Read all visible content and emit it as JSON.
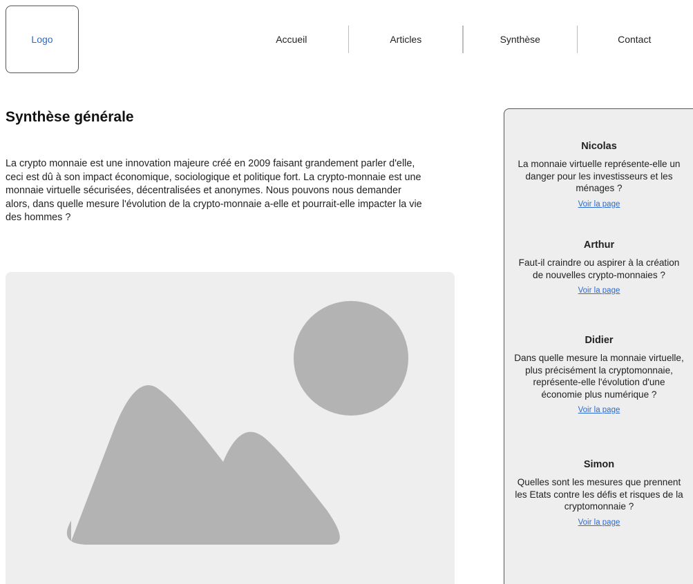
{
  "header": {
    "logo_label": "Logo",
    "nav": [
      {
        "label": "Accueil"
      },
      {
        "label": "Articles"
      },
      {
        "label": "Synthèse"
      },
      {
        "label": "Contact"
      }
    ]
  },
  "main": {
    "title": "Synthèse générale",
    "intro": "La crypto monnaie est une innovation majeure créé en 2009 faisant grandement parler d'elle, ceci est dû à son impact économique, sociologique et politique fort. La crypto-monnaie est une monnaie virtuelle sécurisées, décentralisées et anonymes.  Nous pouvons nous demander alors, dans quelle mesure l'évolution de la crypto-monnaie a-elle et pourrait-elle impacter la vie des hommes ?"
  },
  "sidebar": {
    "cards": [
      {
        "name": "Nicolas",
        "question": "La monnaie virtuelle représente-elle un danger pour les investisseurs et les ménages ?",
        "link": "Voir la page"
      },
      {
        "name": "Arthur",
        "question": "Faut-il craindre ou aspirer à la création de nouvelles crypto-monnaies ?",
        "link": "Voir la page"
      },
      {
        "name": "Didier",
        "question": "Dans quelle mesure la monnaie virtuelle, plus précisément la cryptomonnaie, représente-elle l'évolution d'une économie plus numérique ?",
        "link": "Voir la page"
      },
      {
        "name": "Simon",
        "question": "Quelles sont les mesures que prennent les Etats contre les défis et risques de la cryptomonnaie ?",
        "link": "Voir la page"
      }
    ]
  },
  "colors": {
    "link": "#2a6bd1",
    "placeholder_bg": "#eeeeee",
    "placeholder_shape": "#b3b3b3"
  }
}
